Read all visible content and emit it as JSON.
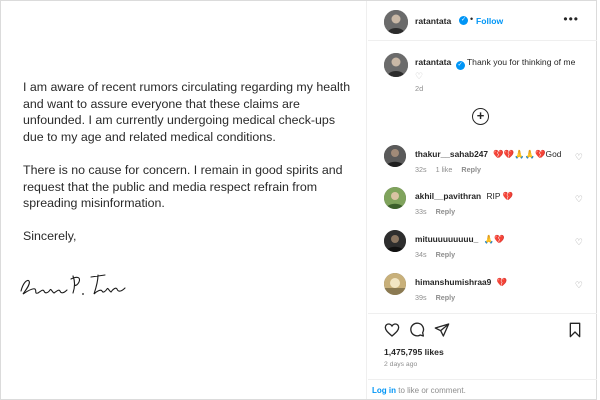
{
  "letter": {
    "paragraph1": "I am aware of recent rumors circulating regarding my health and want to assure everyone that these claims are unfounded. I am currently undergoing medical check-ups due to my age and related medical conditions.",
    "paragraph2": "There is no cause for concern. I remain in good spirits and request that the public and media respect refrain from spreading misinformation.",
    "closing": "Sincerely,"
  },
  "header": {
    "username": "ratantata",
    "separator": "•",
    "follow_label": "Follow",
    "more_icon": "more-horizontal-icon",
    "more_label": "•••"
  },
  "caption": {
    "username": "ratantata",
    "text": "Thank you for thinking of me",
    "heart": "♡",
    "time": "2d"
  },
  "load_more": {
    "label": "+"
  },
  "comments": [
    {
      "username": "thakur__sahab247",
      "text": "💔💔🙏🙏💔God",
      "time": "32s",
      "likes": "1 like",
      "reply": "Reply"
    },
    {
      "username": "akhil__pavithran",
      "text": "RIP 💔",
      "time": "33s",
      "likes": "",
      "reply": "Reply"
    },
    {
      "username": "mituuuuuuuuu_",
      "text": "🙏💔",
      "time": "34s",
      "likes": "",
      "reply": "Reply"
    },
    {
      "username": "himanshumishraa9",
      "text": "💔",
      "time": "39s",
      "likes": "",
      "reply": "Reply"
    }
  ],
  "actions": {
    "likes": "1,475,795 likes",
    "time": "2 days ago"
  },
  "login": {
    "link": "Log in",
    "rest": " to like or comment."
  },
  "colors": {
    "accent": "#0095f6",
    "heart": "#e0245e",
    "muted": "#8e8e8e"
  }
}
